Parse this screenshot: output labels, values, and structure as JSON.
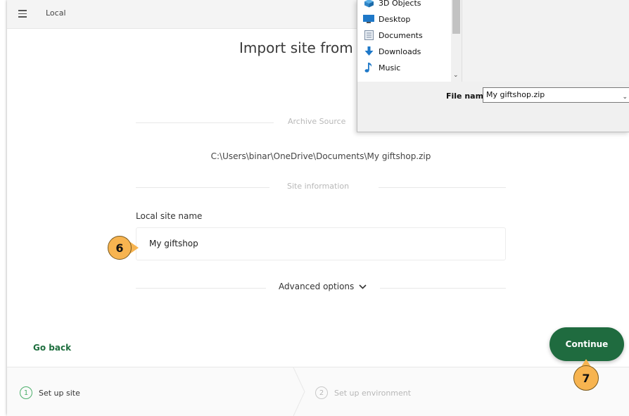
{
  "app": {
    "title": "Local"
  },
  "page": {
    "title": "Import site from a"
  },
  "archive_source": {
    "label": "Archive Source",
    "path": "C:\\Users\\binar\\OneDrive\\Documents\\My giftshop.zip"
  },
  "site_information": {
    "label": "Site information",
    "site_name_label": "Local site name",
    "site_name_value": "My giftshop"
  },
  "advanced": {
    "label": "Advanced options"
  },
  "actions": {
    "go_back": "Go back",
    "continue": "Continue"
  },
  "steps": [
    {
      "number": "1",
      "label": "Set up site",
      "state": "active"
    },
    {
      "number": "2",
      "label": "Set up environment",
      "state": "inactive"
    }
  ],
  "callouts": {
    "step6": "6",
    "step7": "7"
  },
  "file_dialog": {
    "tree_items": [
      {
        "label": "3D Objects",
        "icon": "cube-icon"
      },
      {
        "label": "Desktop",
        "icon": "desktop-icon"
      },
      {
        "label": "Documents",
        "icon": "documents-icon"
      },
      {
        "label": "Downloads",
        "icon": "download-arrow-icon"
      },
      {
        "label": "Music",
        "icon": "music-note-icon"
      }
    ],
    "filename_label": "File name:",
    "filename_value": "My giftshop.zip"
  },
  "colors": {
    "accent_green": "#1f6b3f",
    "step_active": "#4caf6b",
    "callout": "#f7b450"
  }
}
